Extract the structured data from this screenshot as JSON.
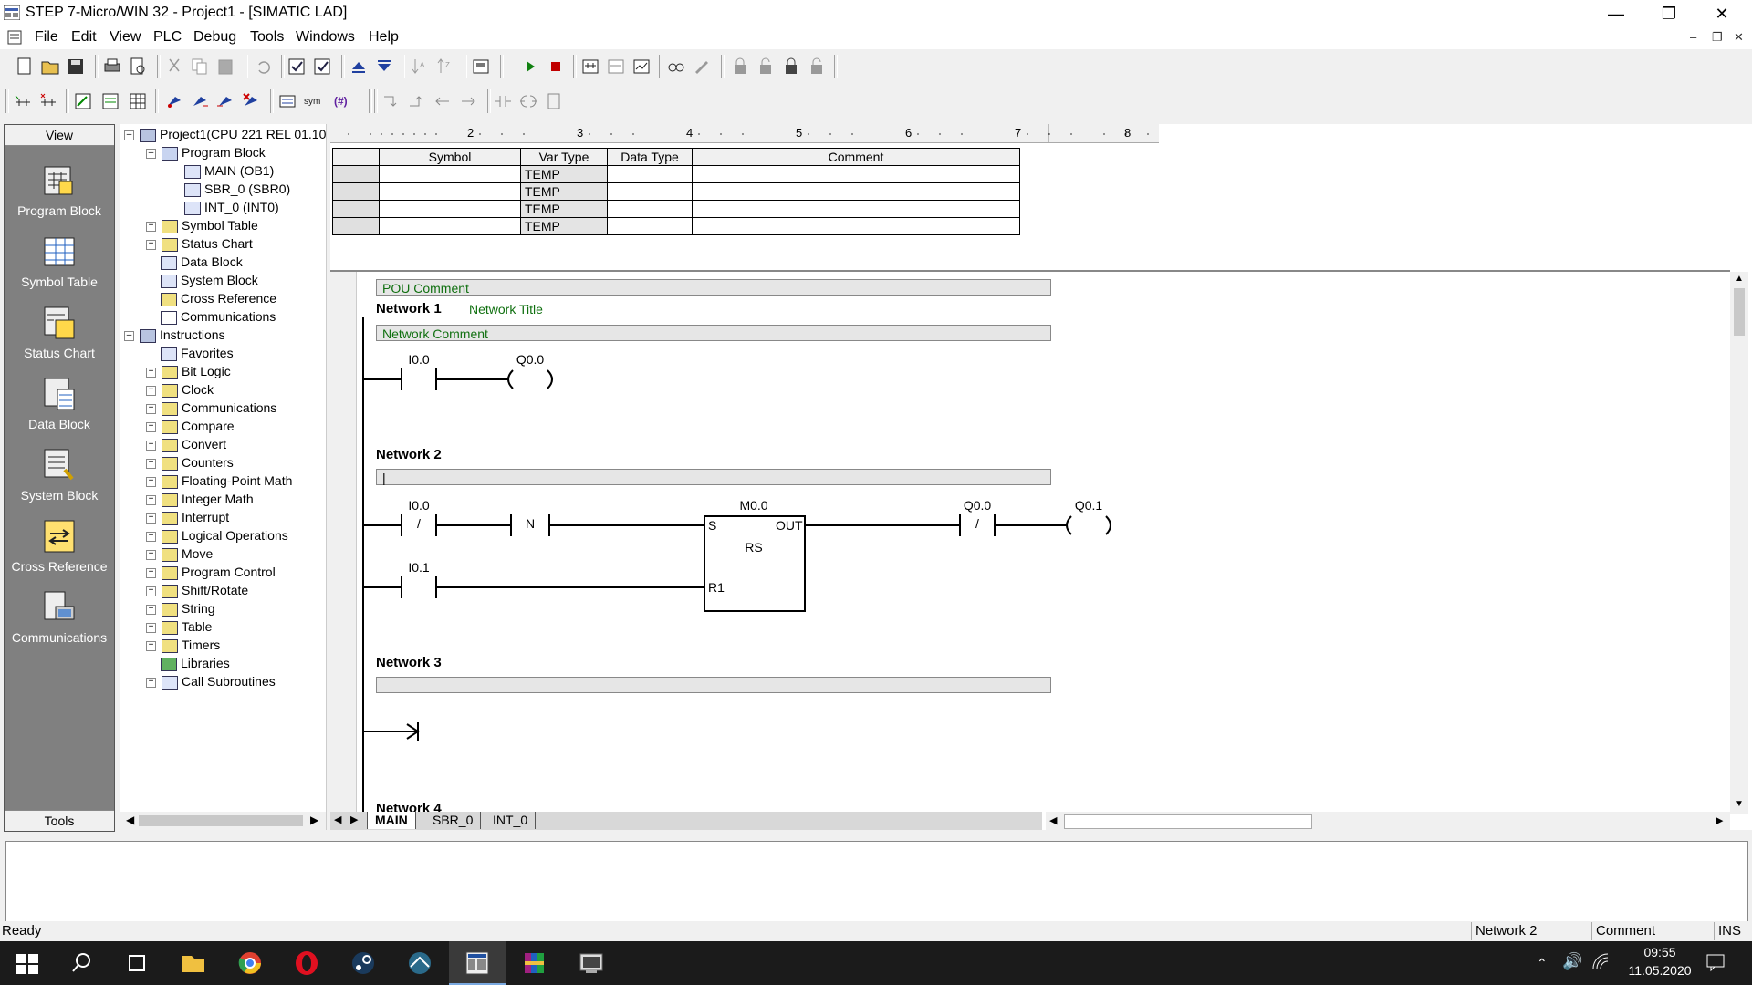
{
  "window": {
    "title": "STEP 7-Micro/WIN 32 - Project1 - [SIMATIC LAD]"
  },
  "menu": [
    "File",
    "Edit",
    "View",
    "PLC",
    "Debug",
    "Tools",
    "Windows",
    "Help"
  ],
  "viewbar": {
    "header": "View",
    "footer": "Tools",
    "items": [
      "Program Block",
      "Symbol Table",
      "Status Chart",
      "Data Block",
      "System Block",
      "Cross Reference",
      "Communications"
    ]
  },
  "tree": {
    "root": "Project1(CPU 221 REL 01.10",
    "program_block": "Program Block",
    "blocks": [
      "MAIN (OB1)",
      "SBR_0 (SBR0)",
      "INT_0 (INT0)"
    ],
    "project_items": [
      "Symbol Table",
      "Status Chart",
      "Data Block",
      "System Block",
      "Cross Reference",
      "Communications"
    ],
    "instructions": "Instructions",
    "instruction_items": [
      "Favorites",
      "Bit Logic",
      "Clock",
      "Communications",
      "Compare",
      "Convert",
      "Counters",
      "Floating-Point Math",
      "Integer Math",
      "Interrupt",
      "Logical Operations",
      "Move",
      "Program Control",
      "Shift/Rotate",
      "String",
      "Table",
      "Timers",
      "Libraries",
      "Call Subroutines"
    ]
  },
  "ruler": [
    "2",
    "3",
    "4",
    "5",
    "6",
    "7",
    "8"
  ],
  "vartable": {
    "headers": [
      "Symbol",
      "Var Type",
      "Data Type",
      "Comment"
    ],
    "rows": [
      {
        "symbol": "",
        "var_type": "TEMP",
        "data_type": "",
        "comment": ""
      },
      {
        "symbol": "",
        "var_type": "TEMP",
        "data_type": "",
        "comment": ""
      },
      {
        "symbol": "",
        "var_type": "TEMP",
        "data_type": "",
        "comment": ""
      },
      {
        "symbol": "",
        "var_type": "TEMP",
        "data_type": "",
        "comment": ""
      }
    ]
  },
  "lad": {
    "pou_comment": "POU Comment",
    "network1": {
      "label": "Network 1",
      "title": "Network Title",
      "comment": "Network Comment",
      "contact": "I0.0",
      "coil": "Q0.0"
    },
    "network2": {
      "label": "Network 2",
      "contact1": "I0.0",
      "contact1_symbol": "/",
      "edge": "N",
      "block_operand": "M0.0",
      "block_type": "RS",
      "block_in_s": "S",
      "block_out": "OUT",
      "block_in_r": "R1",
      "contact2": "I0.1",
      "contact3": "Q0.0",
      "contact3_symbol": "/",
      "coil": "Q0.1"
    },
    "network3": {
      "label": "Network 3"
    },
    "network4": {
      "label": "Network 4"
    }
  },
  "tabs": [
    "MAIN",
    "SBR_0",
    "INT_0"
  ],
  "status": {
    "left": "Ready",
    "network": "Network 2",
    "mode": "Comment",
    "ins": "INS"
  },
  "clock": {
    "time": "09:55",
    "date": "11.05.2020"
  }
}
